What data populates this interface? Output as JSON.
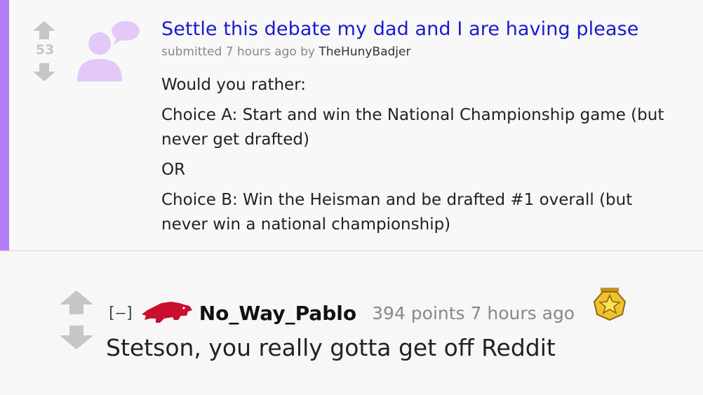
{
  "post": {
    "score": "53",
    "title": "Settle this debate my dad and I are having please",
    "tagline": {
      "prefix": "submitted 7 hours ago by",
      "author": "TheHunyBadjer"
    },
    "body": [
      "Would you rather:",
      "Choice A: Start and win the National Championship game (but never get drafted)",
      "OR",
      "Choice B: Win the Heisman and be drafted #1 overall (but never win a national championship)"
    ],
    "thumbnail_icon": "self-post-user-icon",
    "accent_color": "#b37ff5"
  },
  "comment": {
    "collapse_label": "[–]",
    "flair_icon": "razorback-hog-icon",
    "author": "No_Way_Pablo",
    "meta": "394 points 7 hours ago",
    "award_icon": "gold-star-award-icon",
    "body": "Stetson, you really gotta get off Reddit"
  },
  "colors": {
    "title_link": "#1a1acc",
    "vote_arrow": "#c6c6c6",
    "flair": "#c8102e",
    "award": "#f2c12e"
  }
}
